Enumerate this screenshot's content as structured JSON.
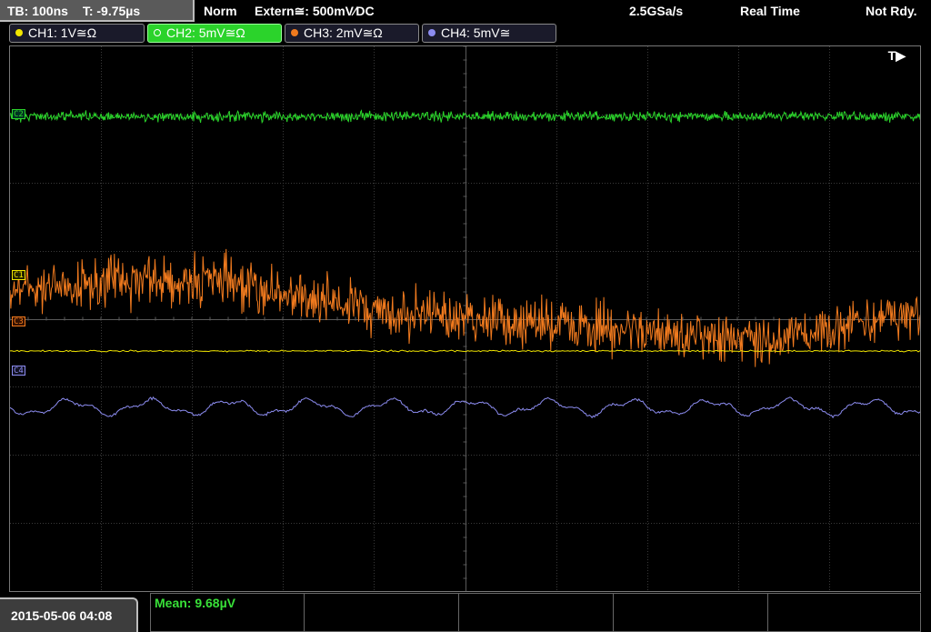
{
  "topbar": {
    "timebase": "TB: 100ns",
    "trigger_time": "T: -9.75µs",
    "mode": "Norm",
    "trigger_source": "Extern≅: 500mV∕DC",
    "sample_rate": "2.5GSa/s",
    "acq_mode": "Real Time",
    "status": "Not Rdy."
  },
  "channels": [
    {
      "label": "CH1: 1V≅Ω",
      "color": "#f2e600"
    },
    {
      "label": "CH2: 5mV≅Ω",
      "color": "#2bd32b"
    },
    {
      "label": "CH3: 2mV≅Ω",
      "color": "#f07a1e"
    },
    {
      "label": "CH4: 5mV≅",
      "color": "#8c8cf0"
    }
  ],
  "markers": {
    "c1": "C1",
    "c2": "C2",
    "c3": "C3",
    "c4": "C4",
    "trigger": "T▶"
  },
  "bottom": {
    "datetime": "2015-05-06 04:08",
    "measurement": "Mean: 9.68µV"
  },
  "colors": {
    "ch1": "#f2e600",
    "ch2": "#2bd32b",
    "ch3": "#f07a1e",
    "ch4": "#8c8cf0",
    "grid": "#3a3a3a",
    "grid_center": "#5a5a5a"
  }
}
